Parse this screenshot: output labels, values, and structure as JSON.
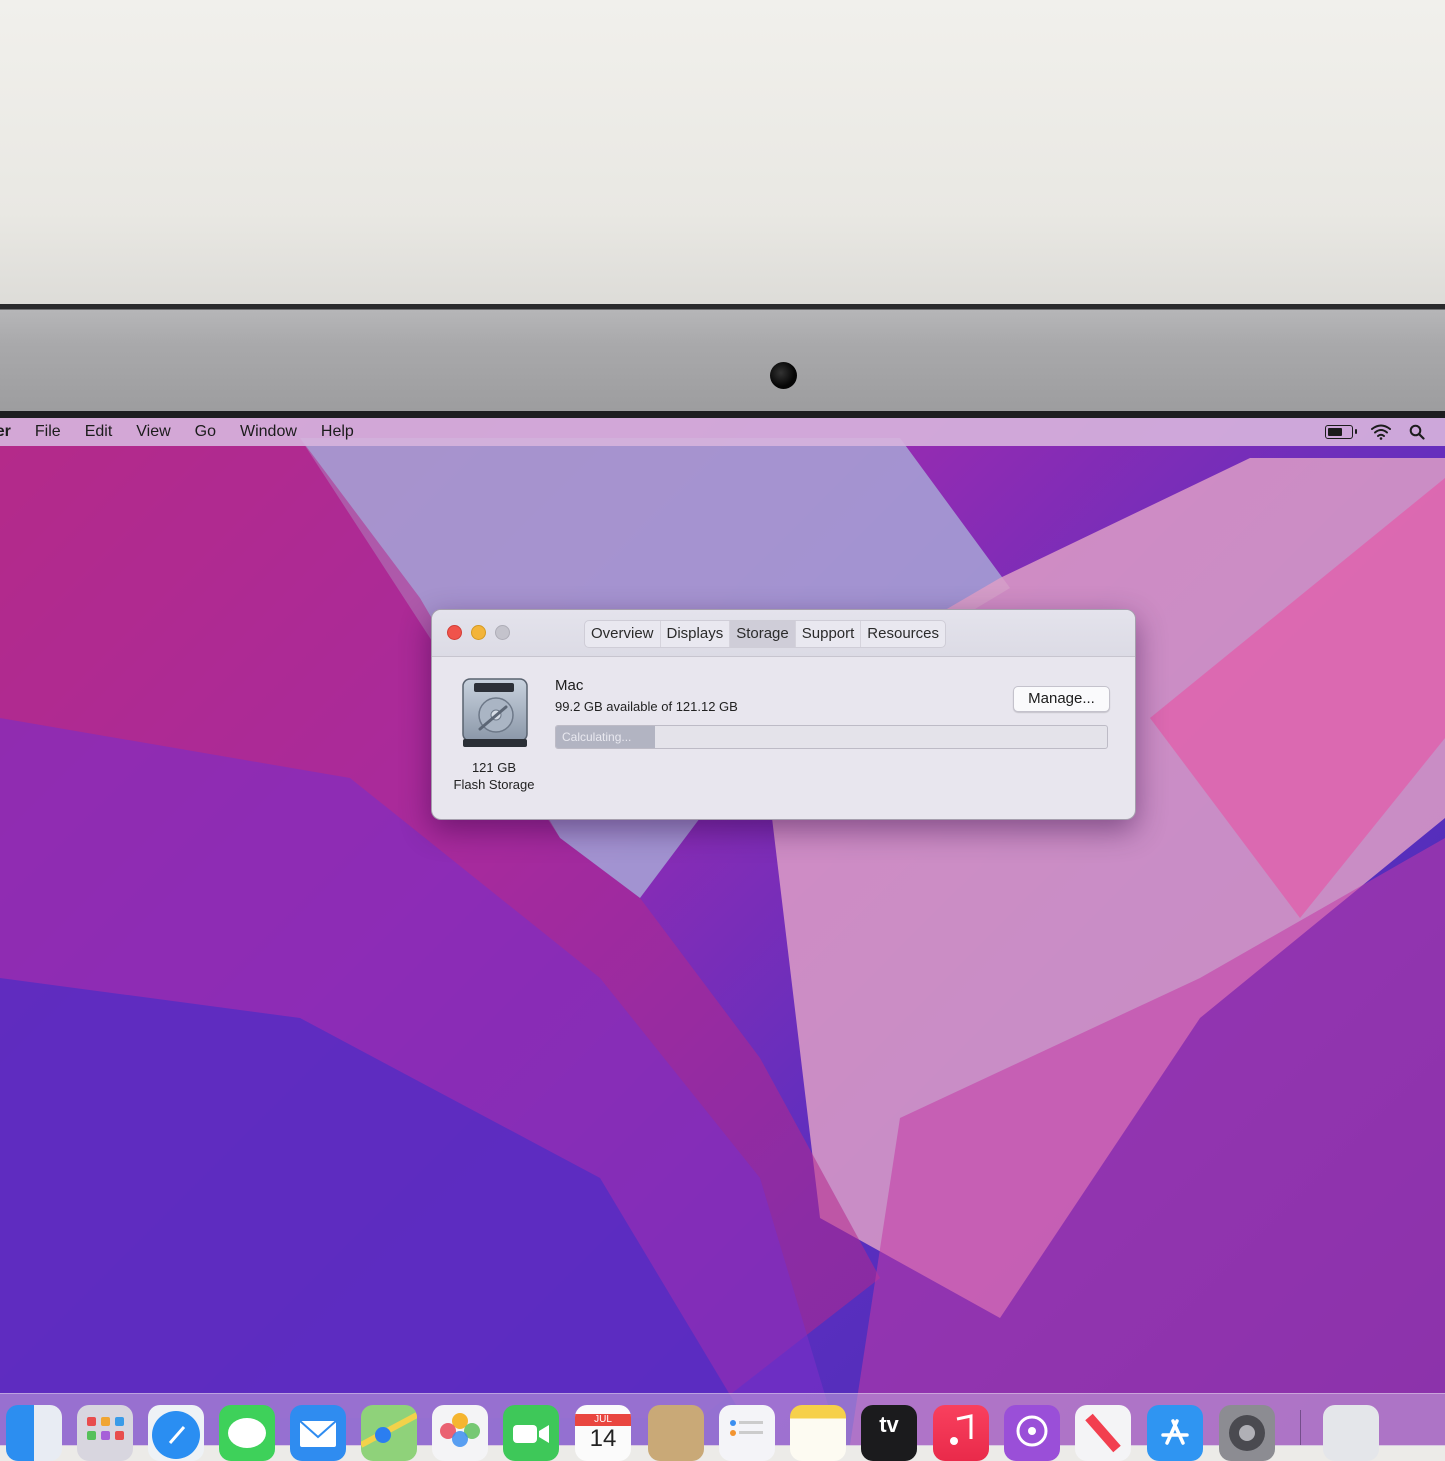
{
  "menubar": {
    "app_name": "der",
    "items": [
      "File",
      "Edit",
      "View",
      "Go",
      "Window",
      "Help"
    ],
    "status_icons": [
      "battery-icon",
      "wifi-icon",
      "spotlight-search-icon"
    ]
  },
  "window": {
    "tabs": [
      "Overview",
      "Displays",
      "Storage",
      "Support",
      "Resources"
    ],
    "active_tab": "Storage",
    "drive": {
      "capacity_label": "121 GB",
      "type_label": "Flash Storage",
      "name": "Mac",
      "availability": "99.2 GB available of 121.12 GB",
      "progress_label": "Calculating...",
      "progress_fraction": 0.18
    },
    "manage_button": "Manage..."
  },
  "dock": {
    "items": [
      "finder-icon",
      "launchpad-icon",
      "safari-icon",
      "messages-icon",
      "mail-icon",
      "maps-icon",
      "photos-icon",
      "facetime-icon",
      "calendar-icon",
      "contacts-icon",
      "reminders-icon",
      "notes-icon",
      "apple-tv-icon",
      "music-icon",
      "podcasts-icon",
      "news-icon",
      "app-store-icon",
      "system-preferences-icon",
      "utilities-icon"
    ],
    "calendar_month": "JUL",
    "calendar_day": "14",
    "tv_label": "tv"
  },
  "colors": {
    "close": "#f0534b",
    "minimize": "#f3b43a",
    "maximize": "#c4c3cc"
  }
}
